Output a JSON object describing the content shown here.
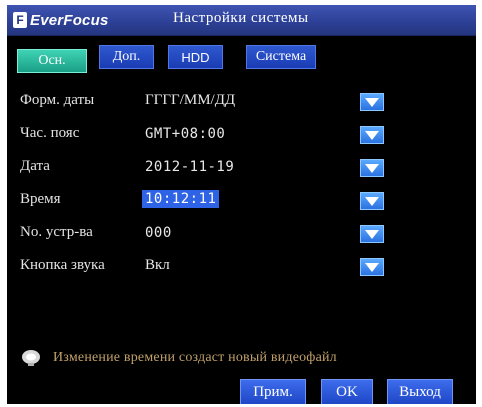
{
  "header": {
    "logo_mark": "F",
    "brand": "EverFocus",
    "title": "Настройки системы"
  },
  "tabs": [
    {
      "label": "Осн.",
      "active": true
    },
    {
      "label": "Доп.",
      "active": false
    },
    {
      "label": "HDD",
      "active": false
    },
    {
      "label": "Система",
      "active": false
    }
  ],
  "settings": [
    {
      "label": "Форм. даты",
      "value": "ГГГГ/ММ/ДД"
    },
    {
      "label": "Час. пояс",
      "value": "GMT+08:00"
    },
    {
      "label": "Дата",
      "value": "2012-11-19"
    },
    {
      "label": "Время",
      "value": "10:12:11",
      "selected": true
    },
    {
      "label": "No. устр-ва",
      "value": "000"
    },
    {
      "label": "Кнопка звука",
      "value": "Вкл"
    }
  ],
  "note": {
    "icon": "info-bulb-icon",
    "text": "Изменение времени создаст новый видеофайл"
  },
  "buttons": {
    "apply": "Прим.",
    "ok": "OK",
    "exit": "Выход"
  },
  "colors": {
    "title_bar": "#2c3f95",
    "active_tab": "#1a9f86",
    "tab": "#1a3cb4",
    "selection": "#2e63e6",
    "note_text": "#c0a06a",
    "background": "#000000"
  }
}
